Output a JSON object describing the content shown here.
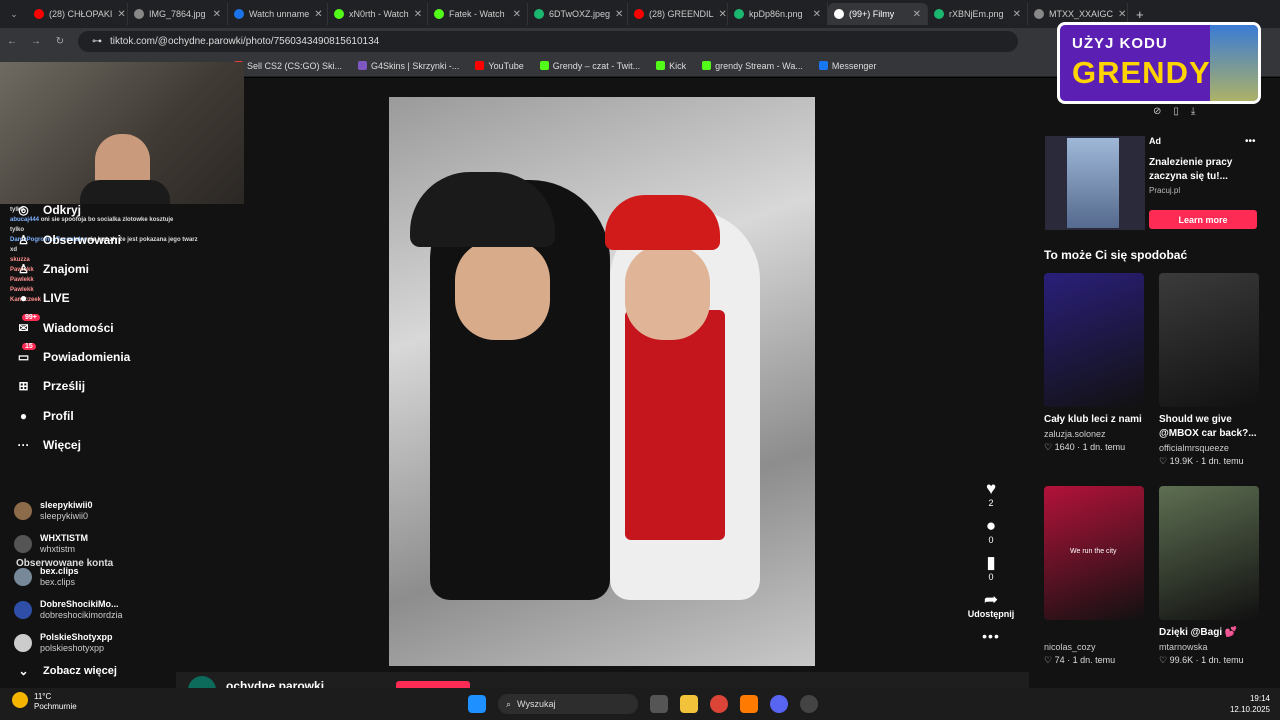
{
  "tabs": [
    {
      "label": "(28) CHŁOPAKI",
      "color": "#ff0000"
    },
    {
      "label": "IMG_7864.jpg",
      "color": "#888888"
    },
    {
      "label": "Watch unname",
      "color": "#1a73e8"
    },
    {
      "label": "xN0rth - Watch",
      "color": "#53fc18"
    },
    {
      "label": "Fatek - Watch",
      "color": "#53fc18"
    },
    {
      "label": "6DTwOXZ.jpeg",
      "color": "#1bb76e"
    },
    {
      "label": "(28) GREENDIL",
      "color": "#ff0000"
    },
    {
      "label": "kpDp86n.png",
      "color": "#1bb76e"
    },
    {
      "label": "(99+) Filmy",
      "color": "#ffffff"
    },
    {
      "label": "rXBNjEm.png",
      "color": "#1bb76e"
    },
    {
      "label": "MTXX_XXAIGC",
      "color": "#888888"
    }
  ],
  "url": "tiktok.com/@ochydne.parowki/photo/7560343490815610134",
  "bookmarks": [
    {
      "label": "Sell CS2 (CS:GO) Ski...",
      "color": "#e53935"
    },
    {
      "label": "G4Skins | Skrzynki -...",
      "color": "#7e57c2"
    },
    {
      "label": "YouTube",
      "color": "#ff0000"
    },
    {
      "label": "Grendy – czat - Twit...",
      "color": "#53fc18"
    },
    {
      "label": "Kick",
      "color": "#53fc18"
    },
    {
      "label": "grendy Stream - Wa...",
      "color": "#53fc18"
    },
    {
      "label": "Messenger",
      "color": "#1877f2"
    }
  ],
  "sidebar": {
    "items": [
      {
        "label": "Odkryj",
        "icon": "compass-icon",
        "glyph": "◎"
      },
      {
        "label": "Obserwowani",
        "icon": "following-icon",
        "glyph": "♙"
      },
      {
        "label": "Znajomi",
        "icon": "friends-icon",
        "glyph": "♙"
      },
      {
        "label": "LIVE",
        "icon": "live-icon",
        "glyph": "●"
      },
      {
        "label": "Wiadomości",
        "icon": "messages-icon",
        "glyph": "✉",
        "badge": "99+"
      },
      {
        "label": "Powiadomienia",
        "icon": "notifications-icon",
        "glyph": "▭",
        "badge": "15"
      },
      {
        "label": "Prześlij",
        "icon": "upload-icon",
        "glyph": "⊞"
      },
      {
        "label": "Profil",
        "icon": "profile-icon",
        "glyph": "●"
      },
      {
        "label": "Więcej",
        "icon": "more-icon",
        "glyph": "···"
      }
    ],
    "following_title": "Obserwowane konta",
    "accounts": [
      {
        "name": "sleepykiwii0",
        "handle": "sleepykiwii0",
        "color": "#8b6b4a"
      },
      {
        "name": "WHXTISTM",
        "handle": "whxtistm",
        "color": "#555555"
      },
      {
        "name": "bex.clips",
        "handle": "bex.clips",
        "color": "#778899"
      },
      {
        "name": "DobreShocikiMo...",
        "handle": "dobreshocikimordzia",
        "color": "#2e4ea8"
      },
      {
        "name": "PolskieShotyxpp",
        "handle": "polskieshotyxpp",
        "color": "#cccccc"
      }
    ],
    "see_more": "Zobacz więcej"
  },
  "chat": [
    {
      "user": "",
      "text": "tylko"
    },
    {
      "user": "abucaj444",
      "text": "oni sie spoofoja bo socialka zlotowke kosztuje"
    },
    {
      "user": "",
      "text": "tylko"
    },
    {
      "user": "DantePogromcaTwronlaku",
      "text": "nie jest zły że jest pokazana jego twarz"
    },
    {
      "user": "",
      "text": "xd"
    },
    {
      "user": "skuzza",
      "text": ""
    },
    {
      "user": "Pawlekk",
      "text": ""
    },
    {
      "user": "Pawlekk",
      "text": ""
    },
    {
      "user": "Pawlekk",
      "text": ""
    },
    {
      "user": "Kamiczeek",
      "text": ""
    }
  ],
  "actions": {
    "likes": "2",
    "comments": "0",
    "saves": "0",
    "share_label": "Udostępnij"
  },
  "bottom_user": "ochydne.parowki",
  "promo": {
    "line1": "UŻYJ KODU",
    "line2": "GRENDY"
  },
  "ad": {
    "tag": "Ad",
    "title": "Znalezienie pracy zaczyna się tu!...",
    "source": "Pracuj.pl",
    "button": "Learn more"
  },
  "recommend_title": "To może Ci się spodobać",
  "cards": [
    {
      "title": "Cały klub leci z nami",
      "author": "zaluzja.solonez",
      "meta": "♡ 1640 · 1 dn. temu",
      "color": "#2a1f7a",
      "overlay": ""
    },
    {
      "title": "Should we give @MBOX car back?...",
      "author": "officialmrsqueeze",
      "meta": "♡ 19.9K · 1 dn. temu",
      "color": "#3b3b3b",
      "overlay": ""
    },
    {
      "title": "",
      "author": "nicolas_cozy",
      "meta": "♡ 74 · 1 dn. temu",
      "color": "#b3123a",
      "overlay": "We run the city"
    },
    {
      "title": "Dzięki @Bagi 💕",
      "author": "mtarnowska",
      "meta": "♡ 99.6K · 1 dn. temu",
      "color": "#5e6f52",
      "overlay": ""
    }
  ],
  "taskbar": {
    "temp": "11°C",
    "weather": "Pochmurnie",
    "search": "Wyszukaj",
    "time": "19:14",
    "date": "12.10.2025"
  }
}
